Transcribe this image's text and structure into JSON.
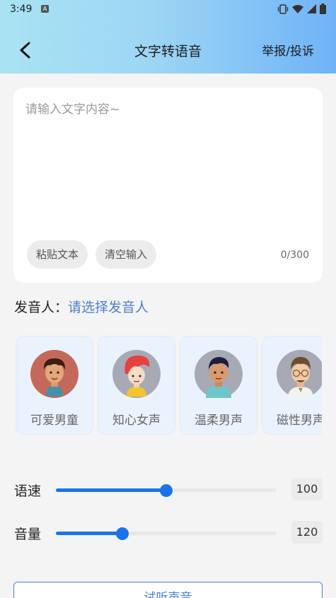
{
  "status_bar": {
    "time": "3:49",
    "notification_icon": "A"
  },
  "header": {
    "title": "文字转语音",
    "report_label": "举报/投诉"
  },
  "text_input": {
    "placeholder": "请输入文字内容~",
    "paste_label": "粘贴文本",
    "clear_label": "清空输入",
    "counter": "0/300"
  },
  "speaker": {
    "label": "发音人：",
    "select_prompt": "请选择发音人"
  },
  "voices": [
    {
      "name": "可爱男童",
      "avatar": "boy-avatar-icon"
    },
    {
      "name": "知心女声",
      "avatar": "woman-avatar-icon"
    },
    {
      "name": "温柔男声",
      "avatar": "man-avatar-icon"
    },
    {
      "name": "磁性男声",
      "avatar": "glasses-man-avatar-icon"
    }
  ],
  "sliders": {
    "speed": {
      "label": "语速",
      "value": "100",
      "fraction": 0.5
    },
    "volume": {
      "label": "音量",
      "value": "120",
      "fraction": 0.3
    }
  },
  "bottom_button": {
    "label": "试听声音"
  },
  "colors": {
    "accent": "#1a73e8",
    "link": "#4a7fd0"
  }
}
